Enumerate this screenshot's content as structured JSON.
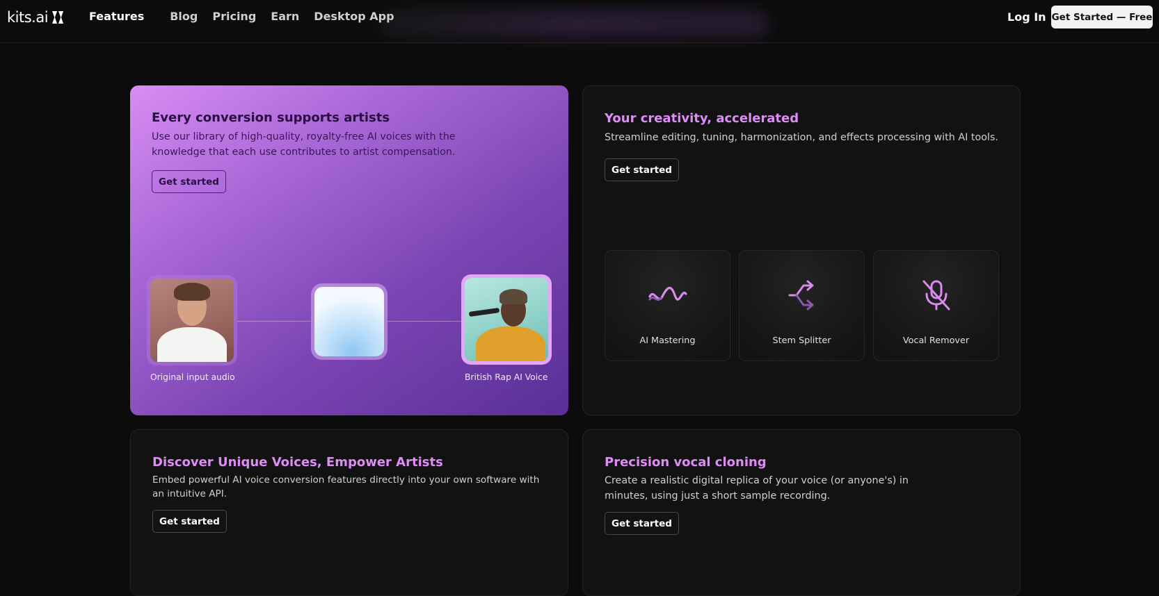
{
  "nav": {
    "logo_text": "kits.ai",
    "links": [
      "Features",
      "Blog",
      "Pricing",
      "Earn",
      "Desktop App"
    ],
    "login": "Log In",
    "cta": "Get Started — Free"
  },
  "cards": {
    "artists": {
      "title": "Every conversion supports artists",
      "body": "Use our library of high-quality, royalty-free AI voices with the knowledge that each use contributes to artist compensation.",
      "button": "Get started",
      "input_caption": "Original input audio",
      "output_caption": "British Rap AI Voice"
    },
    "tools": {
      "title": "Your creativity, accelerated",
      "body": "Streamline editing, tuning, harmonization, and effects processing with AI tools.",
      "button": "Get started",
      "items": [
        {
          "label": "AI Mastering",
          "icon": "waveform-icon"
        },
        {
          "label": "Stem Splitter",
          "icon": "split-arrows-icon"
        },
        {
          "label": "Vocal Remover",
          "icon": "mic-off-icon"
        }
      ]
    },
    "api": {
      "title": "Discover Unique Voices, Empower Artists",
      "body": "Embed powerful AI voice conversion features directly into your own software with an intuitive API.",
      "button": "Get started"
    },
    "cloning": {
      "title": "Precision vocal cloning",
      "body": "Create a realistic digital replica of your voice (or anyone's) in minutes, using just a short sample recording.",
      "button": "Get started"
    }
  },
  "colors": {
    "accent": "#df8cf6",
    "background": "#0c0c0c",
    "card": "#121212"
  }
}
